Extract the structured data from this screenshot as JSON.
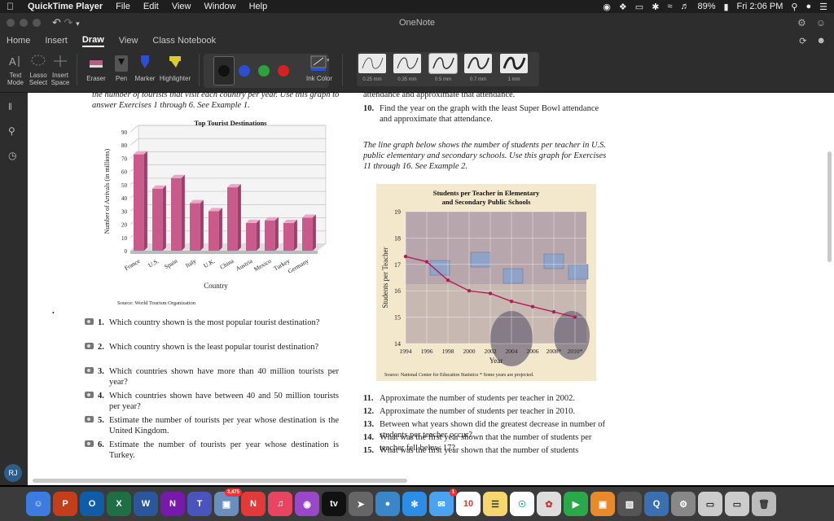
{
  "menubar": {
    "app": "QuickTime Player",
    "items": [
      "File",
      "Edit",
      "View",
      "Window",
      "Help"
    ],
    "battery": "89%",
    "clock": "Fri 2:06 PM"
  },
  "window": {
    "title": "OneNote"
  },
  "ribbon": {
    "tabs": [
      "Home",
      "Insert",
      "Draw",
      "View",
      "Class Notebook"
    ],
    "active_tab": "Draw",
    "tools": {
      "text_mode": "Text Mode",
      "lasso_select": "Lasso Select",
      "insert_space": "Insert Space",
      "eraser": "Eraser",
      "pen": "Pen",
      "marker": "Marker",
      "highlighter": "Highlighter",
      "ink_color": "Ink Color"
    },
    "pen_colors": [
      "#111111",
      "#2b4fd1",
      "#2fa13b",
      "#d32222"
    ],
    "stroke_widths": [
      "0.25 mm",
      "0.35 mm",
      "0.5 mm",
      "0.7 mm",
      "1 mm"
    ],
    "selected_width": "0.5 mm"
  },
  "sidebar": {
    "avatar": "RJ"
  },
  "page": {
    "left_intro": "the number of tourists that visit each country per year. Use this graph to answer Exercises 1 through 6. See Example 1.",
    "left_exercises": [
      {
        "num": "1.",
        "text": "Which country shown is the most popular tourist destination?"
      },
      {
        "num": "2.",
        "text": "Which country shown is the least popular tourist destination?"
      },
      {
        "num": "3.",
        "text": "Which countries shown have more than 40 million tourists per year?"
      },
      {
        "num": "4.",
        "text": "Which countries shown have between 40 and 50 million tourists per year?"
      },
      {
        "num": "5.",
        "text": "Estimate the number of tourists per year whose destination is the United Kingdom."
      },
      {
        "num": "6.",
        "text": "Estimate the number of tourists per year whose destination is Turkey."
      }
    ],
    "right_top_cut": "attendance and approximate that attendance.",
    "ex10": {
      "num": "10.",
      "text": "Find the year on the graph with the least Super Bowl attendance and approximate that attendance."
    },
    "right_intro": "The line graph below shows the number of students per teacher in U.S. public elementary and secondary schools. Use this graph for Exercises 11 through 16. See Example 2.",
    "right_exercises": [
      {
        "num": "11.",
        "text": "Approximate the number of students per teacher in 2002."
      },
      {
        "num": "12.",
        "text": "Approximate the number of students per teacher in 2010."
      },
      {
        "num": "13.",
        "text": "Between what years shown did the greatest decrease in number of students per teacher occur?"
      },
      {
        "num": "14.",
        "text": "What was the first year shown that the number of students per teacher fell below 17?"
      },
      {
        "num": "15.",
        "text": "What was the first year shown that the number of students"
      }
    ]
  },
  "chart_data": [
    {
      "type": "bar",
      "title": "Top Tourist Destinations",
      "xlabel": "Country",
      "ylabel": "Number of Arrivals (in millions)",
      "categories": [
        "France",
        "U.S.",
        "Spain",
        "Italy",
        "U.K.",
        "China",
        "Austria",
        "Mexico",
        "Turkey",
        "Germany"
      ],
      "values": [
        73,
        47,
        55,
        36,
        30,
        48,
        21,
        23,
        21,
        25
      ],
      "ylim": [
        0,
        90
      ],
      "yticks": [
        0,
        10,
        20,
        30,
        40,
        50,
        60,
        70,
        80,
        90
      ],
      "source": "Source: World Tourism Organization",
      "color": "#c85a8c"
    },
    {
      "type": "line",
      "title": "Students per Teacher in Elementary and Secondary Public Schools",
      "xlabel": "Year",
      "ylabel": "Students per Teacher",
      "x": [
        "1994",
        "1996",
        "1998",
        "2000",
        "2002",
        "2004",
        "2006",
        "2008*",
        "2010*"
      ],
      "values": [
        17.3,
        17.1,
        16.4,
        16.0,
        15.9,
        15.6,
        15.4,
        15.2,
        15.0
      ],
      "ylim": [
        14,
        19
      ],
      "yticks": [
        14,
        15,
        16,
        17,
        18,
        19
      ],
      "source": "Source: National Center for Education Statistics   * Some years are projected.",
      "color": "#b01e5a"
    }
  ]
}
